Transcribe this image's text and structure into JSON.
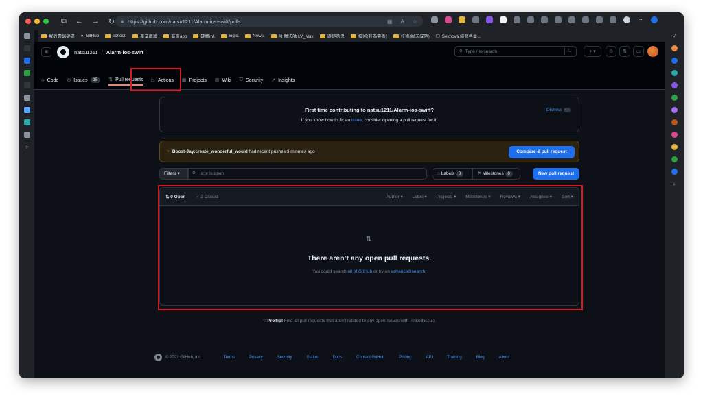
{
  "browser": {
    "url": "https://github.com/natsu1211/Alarm-ios-swift/pulls",
    "bookmarks": [
      "我的雲端硬碟",
      "GitHub",
      "school.",
      "產業概論",
      "新奇app",
      "硬體inf.",
      "logic.",
      "News.",
      "AI 魔法師 LV_Max",
      "遊鉅意思",
      "技術(較為完善)",
      "技術(尚未成熟)",
      "Seknova 練習各量..."
    ]
  },
  "repo": {
    "owner": "natsu1211",
    "separator": "/",
    "name": "Alarm-ios-swift"
  },
  "search": {
    "placeholder": "Type / to search"
  },
  "tabs": {
    "code": "Code",
    "issues": "Issues",
    "issues_count": "15",
    "pulls": "Pull requests",
    "actions": "Actions",
    "projects": "Projects",
    "wiki": "Wiki",
    "security": "Security",
    "insights": "Insights"
  },
  "first_time": {
    "title": "First time contributing to natsu1211/Alarm-ios-swift?",
    "sub_pre": "If you know how to fix an ",
    "sub_link": "issue",
    "sub_post": ", consider opening a pull request for it.",
    "dismiss": "Dismiss"
  },
  "recent_push": {
    "branch": "Boost-Jay:create_wonderful_would",
    "text": " had recent pushes 3 minutes ago",
    "button": "Compare & pull request"
  },
  "filter_bar": {
    "filters": "Filters",
    "query": "is:pr is:open",
    "labels": "Labels",
    "labels_count": "8",
    "milestones": "Milestones",
    "milestones_count": "0",
    "new_pr": "New pull request"
  },
  "list": {
    "open": "0 Open",
    "closed": "2 Closed",
    "menus": [
      "Author",
      "Label",
      "Projects",
      "Milestones",
      "Reviews",
      "Assignee",
      "Sort"
    ],
    "empty_title": "There aren’t any open pull requests.",
    "empty_pre": "You could search ",
    "empty_link1": "all of GitHub",
    "empty_mid": " or try an ",
    "empty_link2": "advanced search",
    "empty_post": "."
  },
  "protip": {
    "label": "ProTip!",
    "text": " Find all pull requests that aren’t related to any open issues with ",
    "code": "-linked:issue",
    "end": "."
  },
  "footer": {
    "copyright": "© 2023 GitHub, Inc.",
    "links": [
      "Terms",
      "Privacy",
      "Security",
      "Status",
      "Docs",
      "Contact GitHub",
      "Pricing",
      "API",
      "Training",
      "Blog",
      "About"
    ]
  },
  "colors": {
    "accent": "#1f6feb",
    "link": "#4493f8",
    "highlight": "#d51a24",
    "bg": "#0d1117"
  }
}
